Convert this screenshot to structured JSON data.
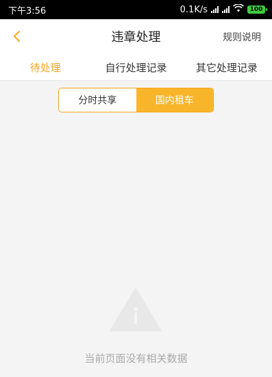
{
  "status_bar": {
    "time": "下午3:56",
    "speed": "0.1K/s",
    "battery": "100"
  },
  "header": {
    "title": "违章处理",
    "right_link": "规则说明"
  },
  "tabs": [
    {
      "label": "待处理",
      "active": true
    },
    {
      "label": "自行处理记录",
      "active": false
    },
    {
      "label": "其它处理记录",
      "active": false
    }
  ],
  "segment": {
    "options": [
      {
        "label": "分时共享",
        "active": false
      },
      {
        "label": "国内租车",
        "active": true
      }
    ]
  },
  "empty_state": {
    "icon": "info-warning-icon",
    "message": "当前页面没有相关数据"
  },
  "colors": {
    "accent": "#f5a623",
    "segment_active_bg": "#f9b529",
    "background": "#f4f4f4"
  }
}
